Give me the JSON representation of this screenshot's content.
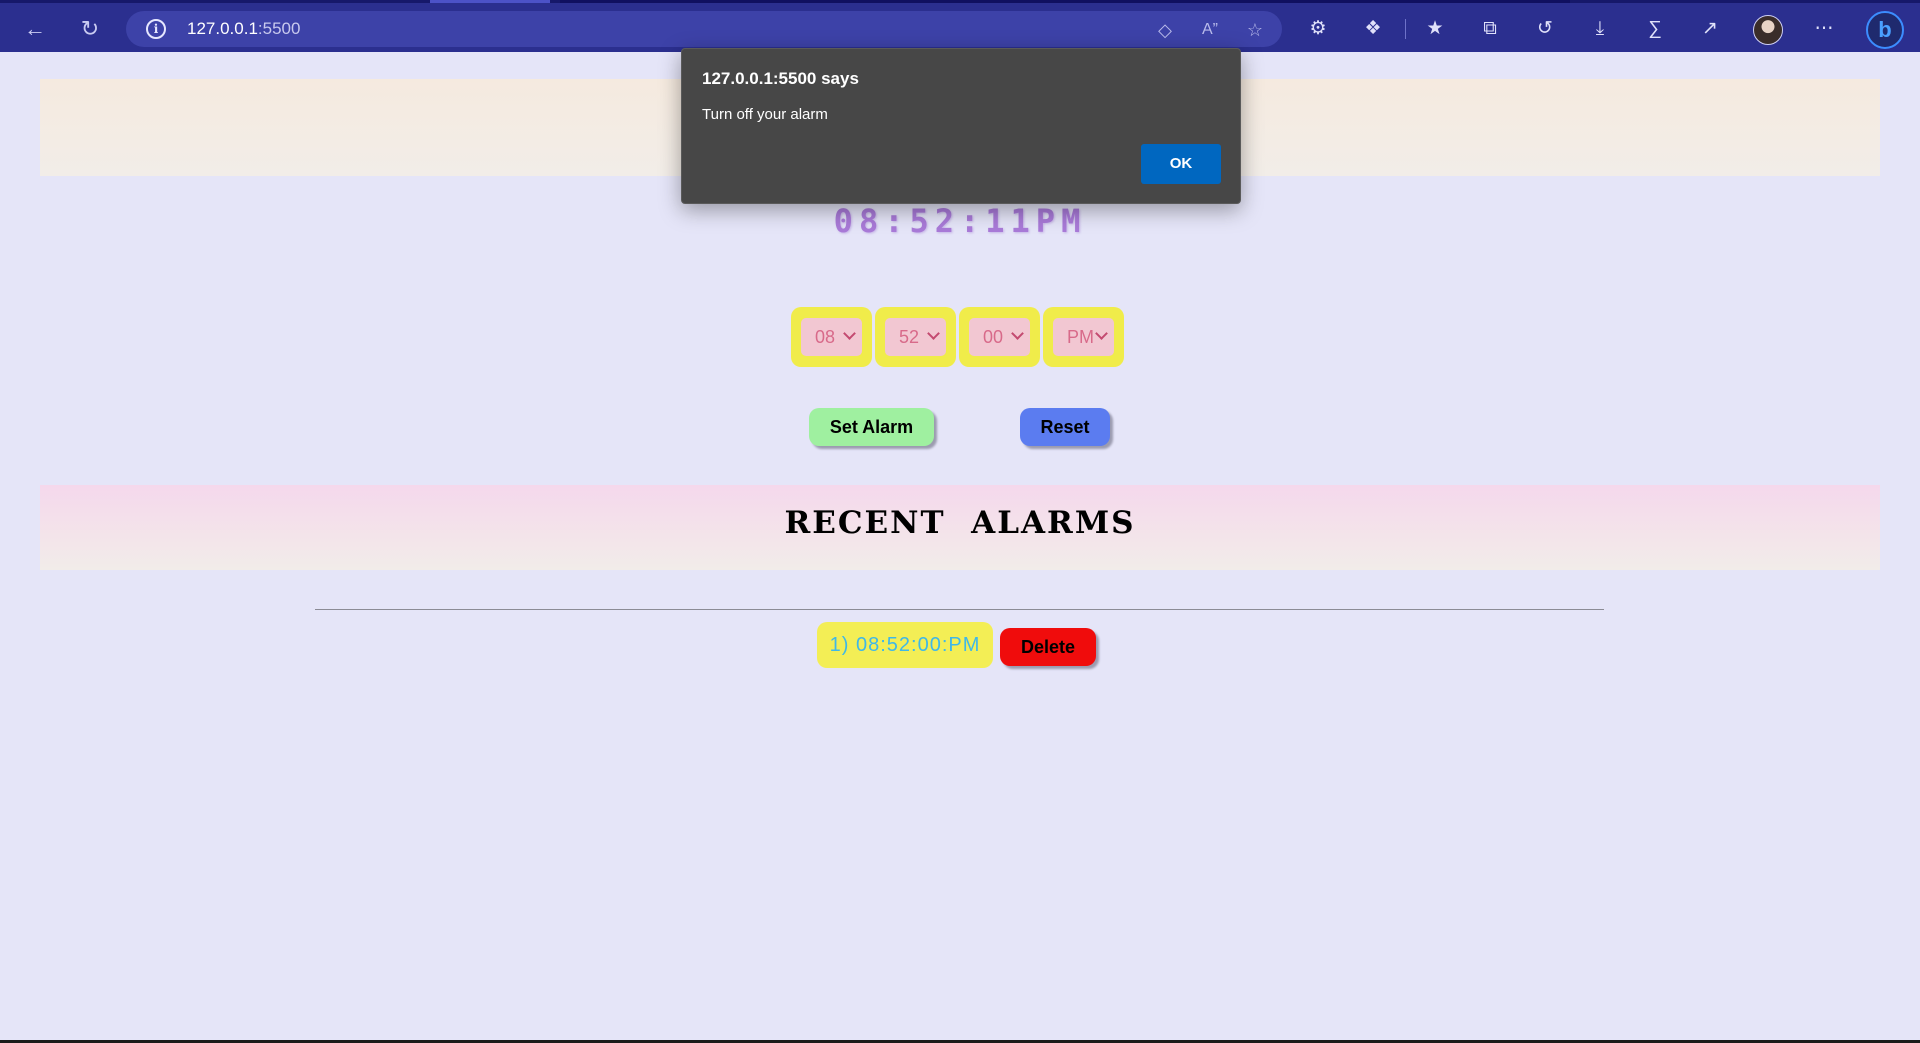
{
  "browser": {
    "url_host": "127.0.0.1",
    "url_port": ":5500",
    "icons": [
      "back-icon",
      "refresh-icon",
      "info-icon",
      "tracking-tag-icon",
      "read-aloud-icon",
      "add-favorite-icon",
      "settings-icon",
      "extensions-icon",
      "favorites-icon",
      "collections-icon",
      "history-icon",
      "downloads-icon",
      "math-solver-icon",
      "share-icon",
      "profile-avatar",
      "more-icon",
      "bing-icon"
    ]
  },
  "dialog": {
    "title": "127.0.0.1:5500 says",
    "message": "Turn off your alarm",
    "ok_label": "OK",
    "ok_color": "#0067c0"
  },
  "clock": {
    "time": "08:52:11PM",
    "color": "#a97ad8"
  },
  "selects": {
    "hour": "08",
    "minute": "52",
    "second": "00",
    "ampm": "PM"
  },
  "buttons": {
    "set_alarm": "Set Alarm",
    "reset": "Reset",
    "delete": "Delete"
  },
  "recent": {
    "title": "RECENT  ALARMS",
    "alarms": [
      {
        "label": "1) 08:52:00:PM"
      }
    ]
  },
  "colors": {
    "page_bg": "#e5e5f8",
    "select_frame": "#f0ec4a",
    "set_alarm_bg": "#9ff0a0",
    "reset_bg": "#5b7cf0",
    "delete_bg": "#f00c0c"
  }
}
